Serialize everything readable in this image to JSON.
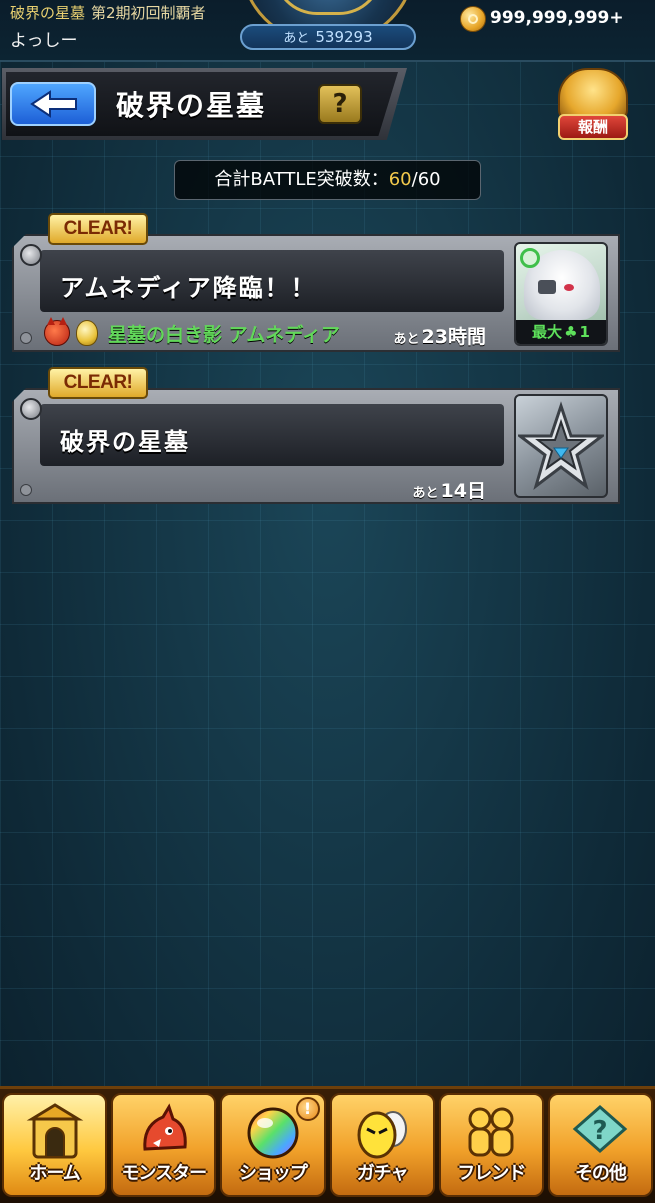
{
  "status_bar": {
    "title_prefix": "破界の星墓",
    "title_suffix": "第2期初回制覇者",
    "username": "よっしー",
    "next_rank_label": "あと",
    "next_rank_value": "539293",
    "coins": "999,999,999+"
  },
  "header": {
    "title": "破界の星墓",
    "help_label": "?",
    "reward_label": "報酬"
  },
  "total": {
    "label": "合計BATTLE突破数：",
    "current": "60",
    "max": "/60"
  },
  "quests": [
    {
      "badge": "CLEAR!",
      "name": "アムネディア降臨！！",
      "boss_name": "星墓の白き影 アムネディア",
      "remaining_prefix": "あと",
      "remaining": "23時間",
      "max_label": "最大",
      "max_clover": "♣",
      "max_value": "1"
    },
    {
      "badge": "CLEAR!",
      "name": "破界の星墓",
      "remaining_prefix": "あと",
      "remaining": "14日"
    }
  ],
  "nav": {
    "items": [
      {
        "label": "ホーム",
        "icon": "castle-icon",
        "active": true
      },
      {
        "label": "モンスター",
        "icon": "dragon-icon"
      },
      {
        "label": "ショップ",
        "icon": "orb-icon",
        "badge": "!"
      },
      {
        "label": "ガチャ",
        "icon": "egg-icon"
      },
      {
        "label": "フレンド",
        "icon": "friends-icon"
      },
      {
        "label": "その他",
        "icon": "more-icon"
      }
    ]
  },
  "colors": {
    "accent_gold": "#f2c94c",
    "boss_green": "#62d85a",
    "back_blue": "#1d5fd6",
    "nav_orange": "#f1a12a"
  }
}
